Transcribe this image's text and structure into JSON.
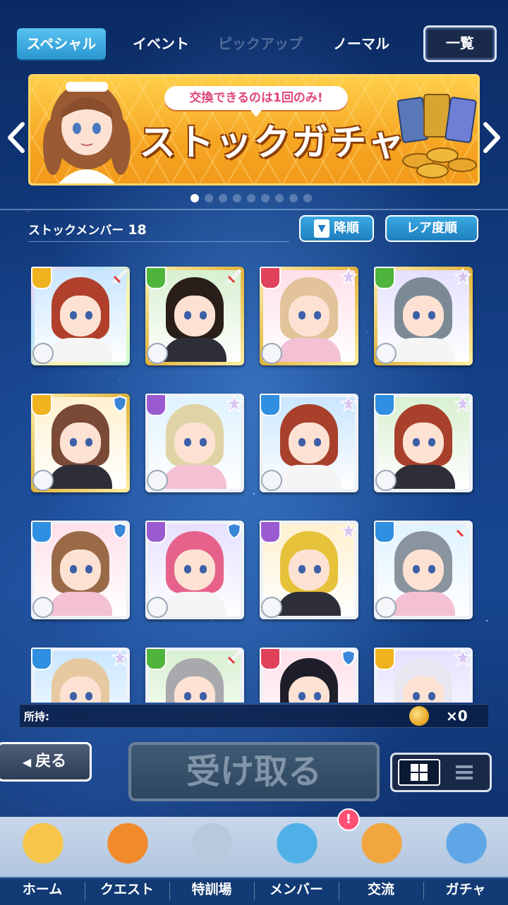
{
  "tabs": [
    {
      "label": "スペシャル",
      "state": "active"
    },
    {
      "label": "イベント",
      "state": "normal"
    },
    {
      "label": "ピックアップ",
      "state": "disabled"
    },
    {
      "label": "ノーマル",
      "state": "normal"
    }
  ],
  "list_button": "一覧",
  "banner": {
    "pill_text": "交換できるのは1回のみ!",
    "title": "ストックガチャ",
    "page_count": 9,
    "active_page": 1
  },
  "stock": {
    "label": "ストックメンバー",
    "count": "18",
    "sort_order_button": "降順",
    "sort_key_button": "レア度順"
  },
  "cards": [
    {
      "attr": "yellow",
      "rank": "sword",
      "frame": "rainbow",
      "hair": "#b0402b",
      "skill": "sword"
    },
    {
      "attr": "green",
      "rank": "sword",
      "frame": "gold",
      "hair": "#2a1e1a",
      "skill": "gear"
    },
    {
      "attr": "red",
      "rank": "star",
      "frame": "gold",
      "hair": "#e2c39a",
      "skill": "sword"
    },
    {
      "attr": "green",
      "rank": "star",
      "frame": "gold",
      "hair": "#7c8a96",
      "skill": "gear"
    },
    {
      "attr": "yellow",
      "rank": "shield",
      "frame": "gold",
      "hair": "#7a4a36",
      "skill": "sword"
    },
    {
      "attr": "purple",
      "rank": "star",
      "frame": "silver",
      "hair": "#e0d3a6",
      "skill": "sword"
    },
    {
      "attr": "blue",
      "rank": "star",
      "frame": "silver",
      "hair": "#a8402c",
      "skill": "sword"
    },
    {
      "attr": "blue",
      "rank": "star",
      "frame": "silver",
      "hair": "#a8402c",
      "skill": "sword"
    },
    {
      "attr": "blue",
      "rank": "shield",
      "frame": "silver",
      "hair": "#9a6a48",
      "skill": "sword"
    },
    {
      "attr": "purple",
      "rank": "shield",
      "frame": "silver",
      "hair": "#e6628a",
      "skill": "hammer"
    },
    {
      "attr": "purple",
      "rank": "star",
      "frame": "silver",
      "hair": "#e6c23a",
      "skill": "sword"
    },
    {
      "attr": "blue",
      "rank": "sword",
      "frame": "silver",
      "hair": "#8a949e",
      "skill": "gear"
    },
    {
      "attr": "blue",
      "rank": "star",
      "frame": "silver",
      "hair": "#e6c9a0",
      "skill": "sword"
    },
    {
      "attr": "green",
      "rank": "sword",
      "frame": "silver",
      "hair": "#a9a9ad",
      "skill": "gear"
    },
    {
      "attr": "red",
      "rank": "shield",
      "frame": "silver",
      "hair": "#1e1e2a",
      "skill": "sword"
    },
    {
      "attr": "yellow",
      "rank": "star",
      "frame": "silver",
      "hair": "#e8e6ee",
      "skill": "sword"
    }
  ],
  "owned": {
    "label": "所持:",
    "quantity": "×0"
  },
  "back_button": "戻る",
  "receive_button": "受け取る",
  "view_toggle": {
    "selected": "grid"
  },
  "nav": [
    {
      "label": "ホーム",
      "icon": "school-icon"
    },
    {
      "label": "クエスト",
      "icon": "devil-icon"
    },
    {
      "label": "特訓場",
      "icon": "crossed-swords-icon"
    },
    {
      "label": "メンバー",
      "icon": "cat-mascot-icon"
    },
    {
      "label": "交流",
      "icon": "map-pin-icon",
      "badge": "!"
    },
    {
      "label": "ガチャ",
      "icon": "curtain-icon"
    }
  ],
  "colors": {
    "attr_yellow": "#f0b21e",
    "attr_green": "#4fb43b",
    "attr_red": "#e0425c",
    "attr_purple": "#9a5ad0",
    "attr_blue": "#2f8fe0",
    "accent": "#2b97d1"
  }
}
